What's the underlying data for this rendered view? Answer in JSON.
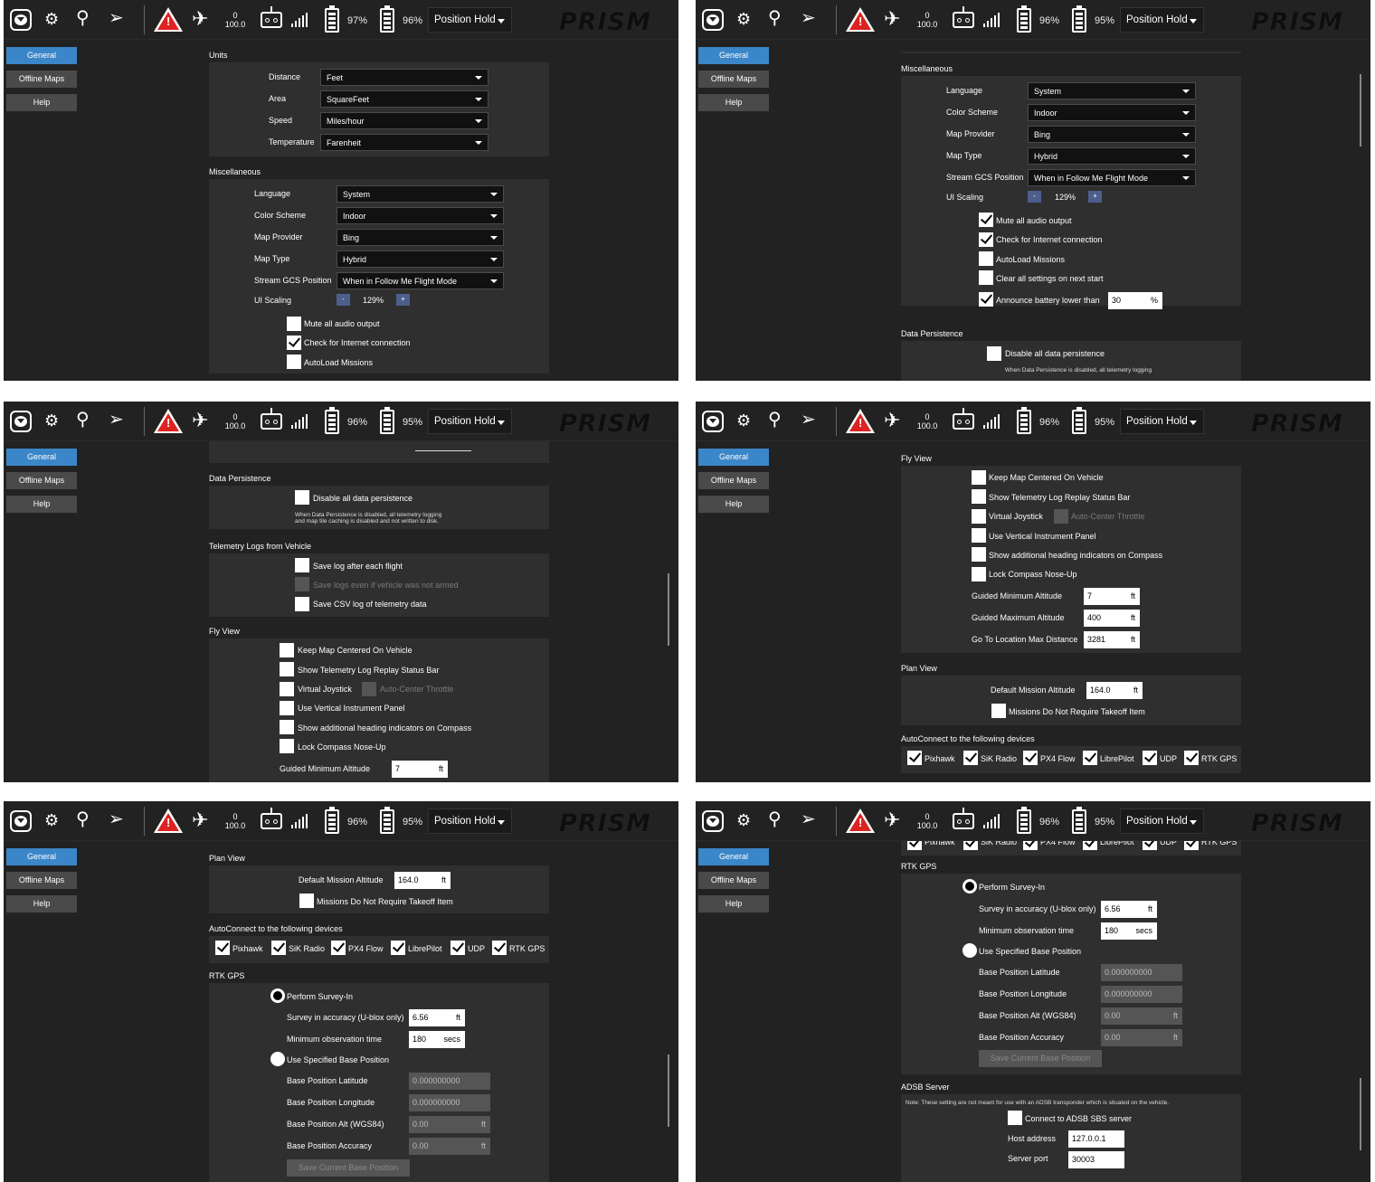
{
  "toolbar": {
    "rc_count": "0",
    "link_quality": "100.0",
    "flight_mode": "Position Hold",
    "logo_text": "PRISM"
  },
  "sidebar": {
    "items": [
      {
        "label": "General",
        "active": true
      },
      {
        "label": "Offline Maps",
        "active": false
      },
      {
        "label": "Help",
        "active": false
      }
    ]
  },
  "battery": {
    "p1": {
      "b1": "97%",
      "b2": "96%"
    },
    "p2": {
      "b1": "96%",
      "b2": "95%"
    },
    "p3": {
      "b1": "96%",
      "b2": "95%"
    },
    "p4": {
      "b1": "96%",
      "b2": "95%"
    },
    "p5": {
      "b1": "96%",
      "b2": "95%"
    },
    "p6": {
      "b1": "96%",
      "b2": "95%"
    }
  },
  "sections": {
    "units": "Units",
    "misc": "Miscellaneous",
    "data_persistence": "Data Persistence",
    "telemetry": "Telemetry Logs from Vehicle",
    "fly_view": "Fly View",
    "plan_view": "Plan View",
    "autoconnect": "AutoConnect to the following devices",
    "rtk": "RTK GPS",
    "adsb": "ADSB Server"
  },
  "units": {
    "distance": {
      "label": "Distance",
      "value": "Feet"
    },
    "area": {
      "label": "Area",
      "value": "SquareFeet"
    },
    "speed": {
      "label": "Speed",
      "value": "Miles/hour"
    },
    "temperature": {
      "label": "Temperature",
      "value": "Farenheit"
    }
  },
  "misc": {
    "language": {
      "label": "Language",
      "value": "System"
    },
    "color_scheme": {
      "label": "Color Scheme",
      "value": "Indoor"
    },
    "map_provider": {
      "label": "Map Provider",
      "value": "Bing"
    },
    "map_type": {
      "label": "Map Type",
      "value": "Hybrid"
    },
    "stream_gcs": {
      "label": "Stream GCS Position",
      "value": "When in Follow Me Flight Mode"
    },
    "ui_scaling": {
      "label": "UI Scaling",
      "value": "129%",
      "minus": "-",
      "plus": "+"
    },
    "mute_audio": {
      "label": "Mute all audio output",
      "checked": true
    },
    "check_internet": {
      "label": "Check for Internet connection",
      "checked": true
    },
    "autoload": {
      "label": "AutoLoad Missions",
      "checked": false
    },
    "clear_settings": {
      "label": "Clear all settings on next start",
      "checked": false
    },
    "announce_battery": {
      "label": "Announce battery lower than",
      "checked": true,
      "value": "30",
      "unit": "%"
    }
  },
  "data_persistence": {
    "disable": {
      "label": "Disable all data persistence",
      "checked": false
    },
    "note_line1": "When Data Persistence is disabled, all telemetry logging",
    "note_line2": "and map tile caching is disabled and not written to disk."
  },
  "telemetry": {
    "save_log": {
      "label": "Save log after each flight",
      "checked": false
    },
    "save_unarmed": {
      "label": "Save logs even if vehicle was not armed",
      "checked": false
    },
    "save_csv": {
      "label": "Save CSV log of telemetry data",
      "checked": false
    }
  },
  "fly_view": {
    "keep_centered": "Keep Map Centered On Vehicle",
    "replay_bar": "Show Telemetry Log Replay Status Bar",
    "virtual_joystick": "Virtual Joystick",
    "auto_center": "Auto-Center Throttle",
    "vertical_panel": "Use Vertical Instrument Panel",
    "heading_indicators": "Show additional heading indicators on Compass",
    "lock_compass": "Lock Compass Nose-Up",
    "min_alt": {
      "label": "Guided Minimum Altitude",
      "value": "7",
      "unit": "ft"
    },
    "max_alt": {
      "label": "Guided Maximum Altitude",
      "value": "400",
      "unit": "ft"
    },
    "max_dist": {
      "label": "Go To Location Max Distance",
      "value": "3281",
      "unit": "ft"
    }
  },
  "plan_view": {
    "default_alt": {
      "label": "Default Mission Altitude",
      "value": "164.0",
      "unit": "ft"
    },
    "no_takeoff": "Missions Do Not Require Takeoff Item"
  },
  "autoconnect": {
    "devices": [
      "Pixhawk",
      "SiK Radio",
      "PX4 Flow",
      "LibrePilot",
      "UDP",
      "RTK GPS"
    ]
  },
  "rtk": {
    "survey_in": "Perform Survey-In",
    "accuracy": {
      "label": "Survey in accuracy (U-blox only)",
      "value": "6.56",
      "unit": "ft"
    },
    "min_obs": {
      "label": "Minimum observation time",
      "value": "180",
      "unit": "secs"
    },
    "specified": "Use Specified Base Position",
    "lat": {
      "label": "Base Position Latitude",
      "value": "0.000000000"
    },
    "lon": {
      "label": "Base Position Longitude",
      "value": "0.000000000"
    },
    "alt": {
      "label": "Base Position Alt (WGS84)",
      "value": "0.00",
      "unit": "ft"
    },
    "acc": {
      "label": "Base Position Accuracy",
      "value": "0.00",
      "unit": "ft"
    },
    "save_btn": "Save Current Base Position"
  },
  "adsb": {
    "note": "Note: These setting are not meant for use with an ADSB transponder which is situated on the vehicle.",
    "connect": "Connect to ADSB SBS server",
    "host": {
      "label": "Host address",
      "value": "127.0.0.1"
    },
    "port_label": "Server port",
    "port_value": "30003"
  }
}
